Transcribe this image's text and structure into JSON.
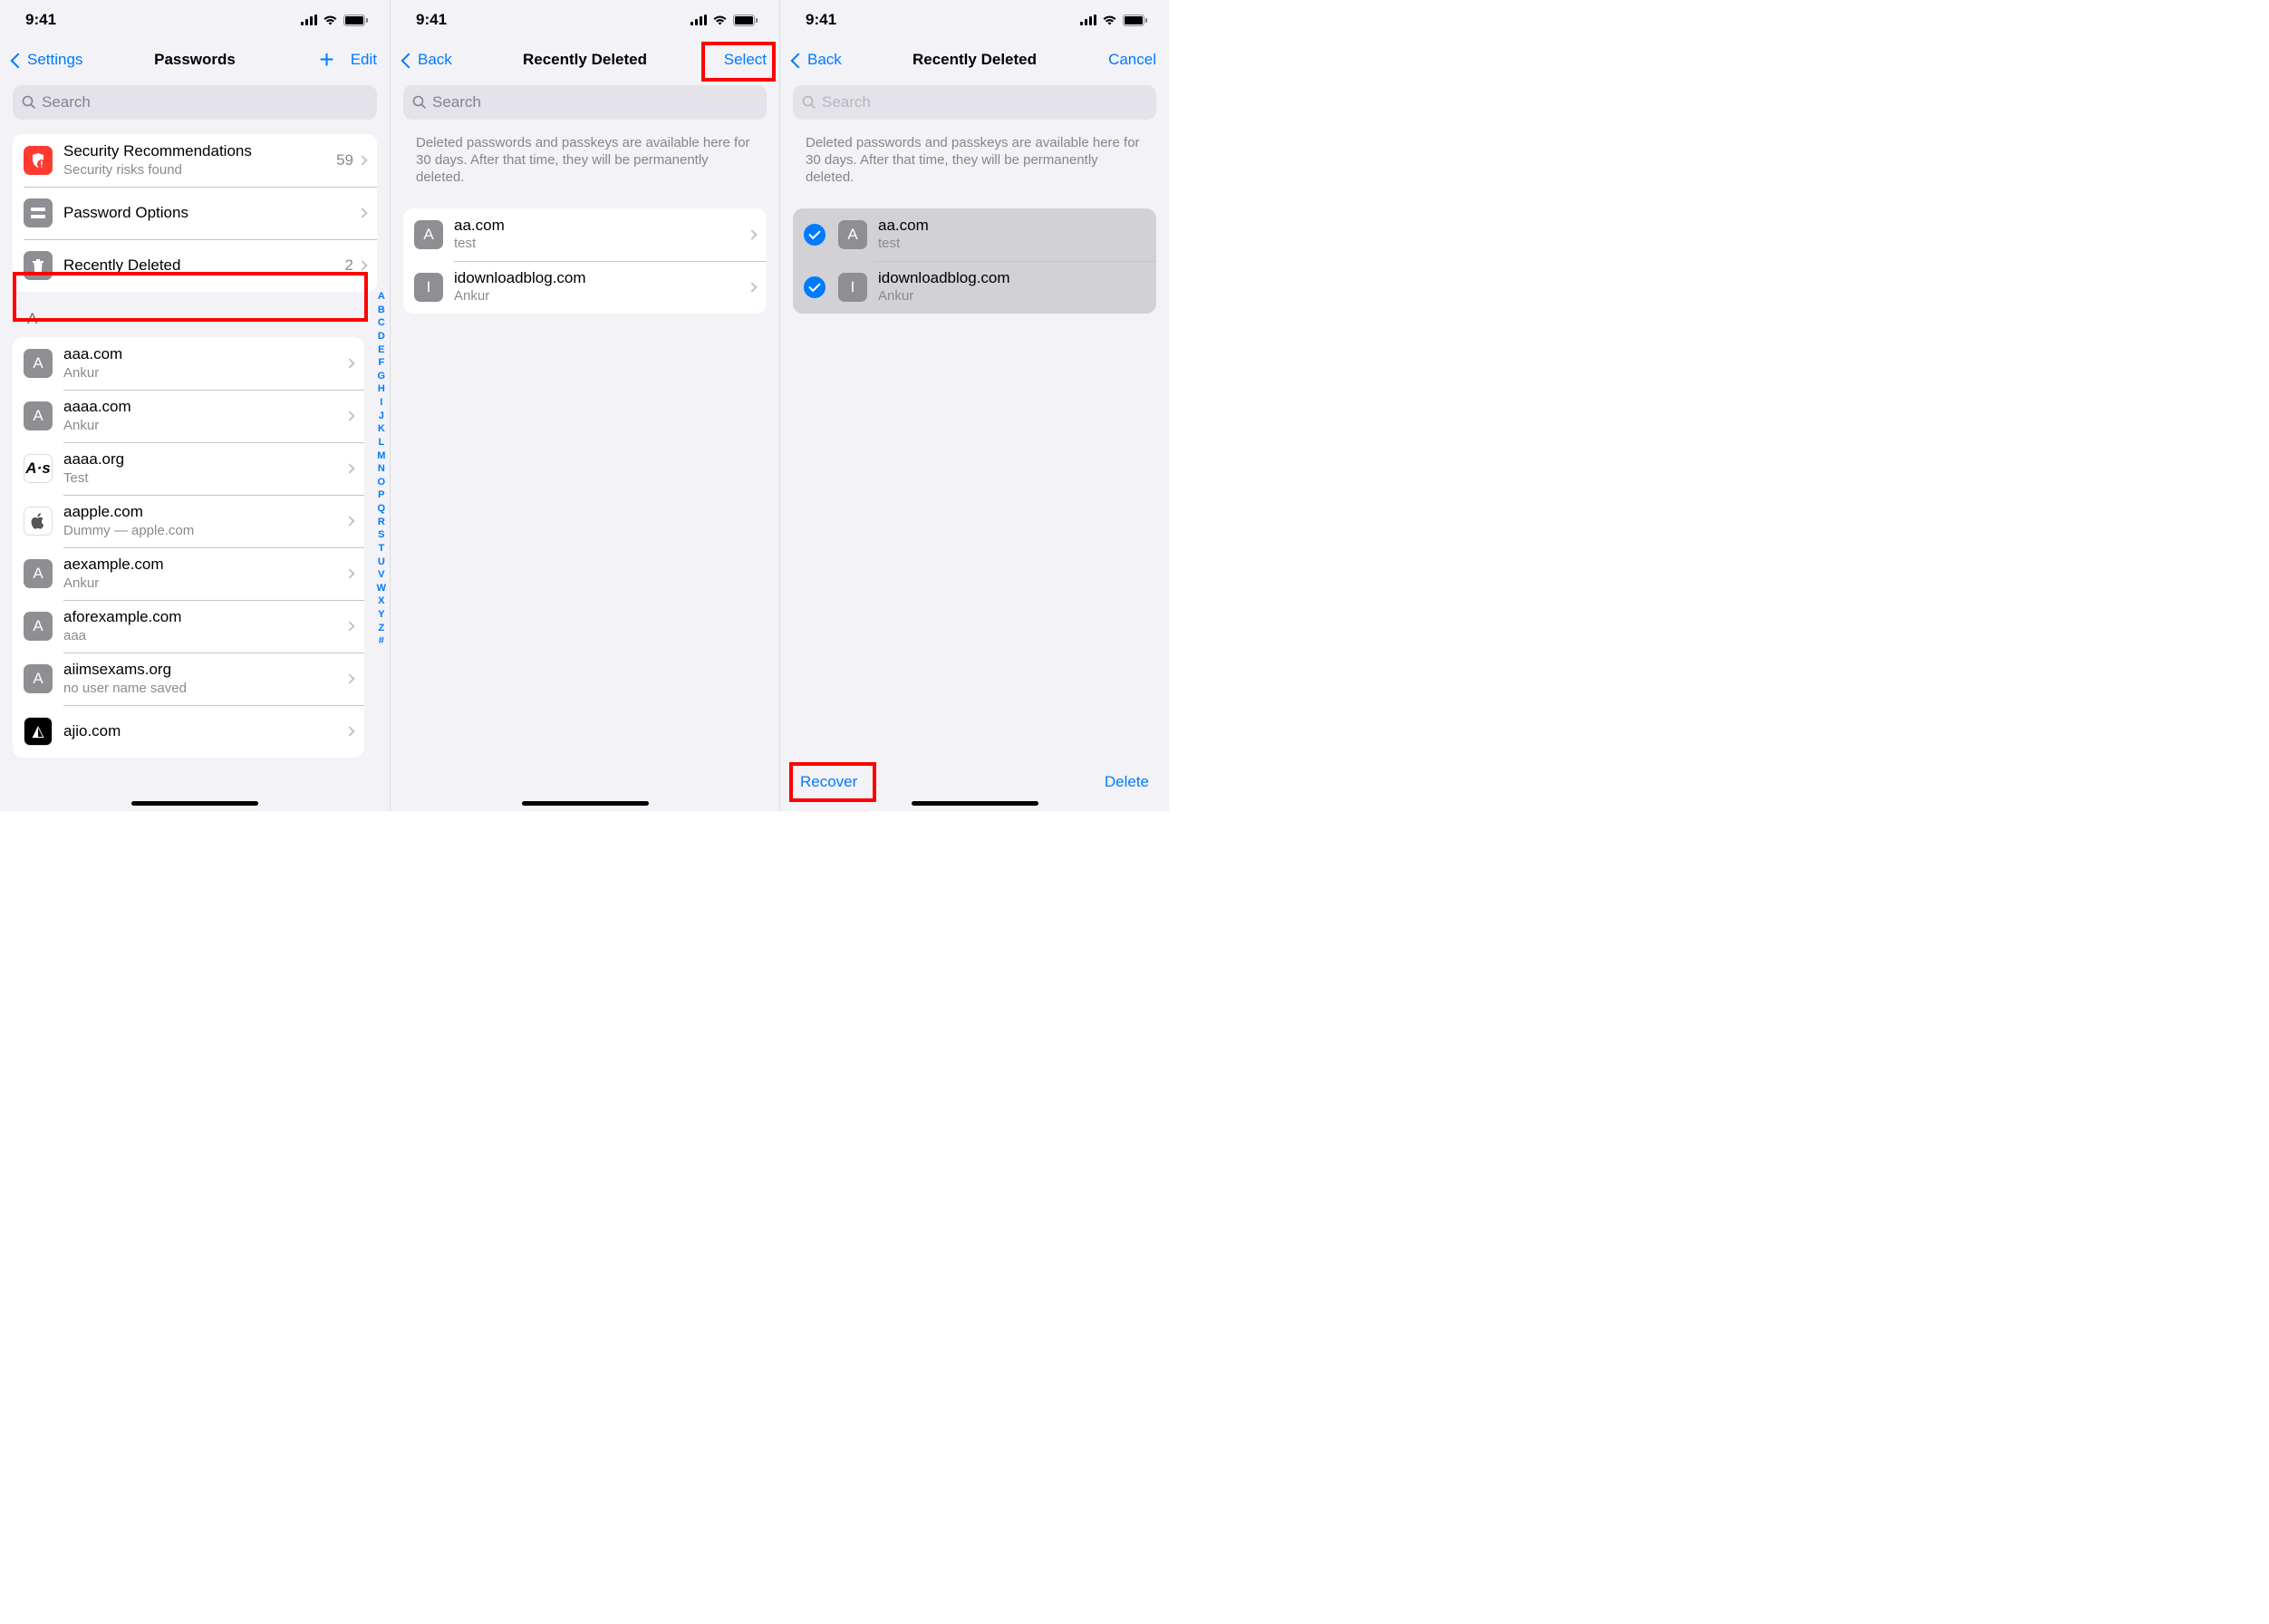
{
  "status": {
    "time": "9:41"
  },
  "screen1": {
    "back": "Settings",
    "title": "Passwords",
    "edit": "Edit",
    "search_placeholder": "Search",
    "top_rows": [
      {
        "title": "Security Recommendations",
        "sub": "Security risks found",
        "trail": "59"
      },
      {
        "title": "Password Options"
      },
      {
        "title": "Recently Deleted",
        "trail": "2"
      }
    ],
    "section": "A",
    "passwords": [
      {
        "letter": "A",
        "site": "aaa.com",
        "user": "Ankur"
      },
      {
        "letter": "A",
        "site": "aaaa.com",
        "user": "Ankur"
      },
      {
        "letter": "A·s",
        "site": "aaaa.org",
        "user": "Test",
        "white": true
      },
      {
        "letter": "",
        "site": "aapple.com",
        "user": "Dummy — apple.com",
        "apple": true
      },
      {
        "letter": "A",
        "site": "aexample.com",
        "user": "Ankur"
      },
      {
        "letter": "A",
        "site": "aforexample.com",
        "user": "aaa"
      },
      {
        "letter": "A",
        "site": "aiimsexams.org",
        "user": "no user name saved"
      },
      {
        "letter": "",
        "site": "ajio.com",
        "user": "",
        "logo": true
      }
    ],
    "index": [
      "A",
      "B",
      "C",
      "D",
      "E",
      "F",
      "G",
      "H",
      "I",
      "J",
      "K",
      "L",
      "M",
      "N",
      "O",
      "P",
      "Q",
      "R",
      "S",
      "T",
      "U",
      "V",
      "W",
      "X",
      "Y",
      "Z",
      "#"
    ]
  },
  "screen2": {
    "back": "Back",
    "title": "Recently Deleted",
    "select": "Select",
    "search_placeholder": "Search",
    "info": "Deleted passwords and passkeys are available here for 30 days. After that time, they will be permanently deleted.",
    "items": [
      {
        "letter": "A",
        "site": "aa.com",
        "user": "test"
      },
      {
        "letter": "I",
        "site": "idownloadblog.com",
        "user": "Ankur"
      }
    ]
  },
  "screen3": {
    "back": "Back",
    "title": "Recently Deleted",
    "cancel": "Cancel",
    "search_placeholder": "Search",
    "info": "Deleted passwords and passkeys are available here for 30 days. After that time, they will be permanently deleted.",
    "items": [
      {
        "letter": "A",
        "site": "aa.com",
        "user": "test"
      },
      {
        "letter": "I",
        "site": "idownloadblog.com",
        "user": "Ankur"
      }
    ],
    "recover": "Recover",
    "delete": "Delete"
  }
}
